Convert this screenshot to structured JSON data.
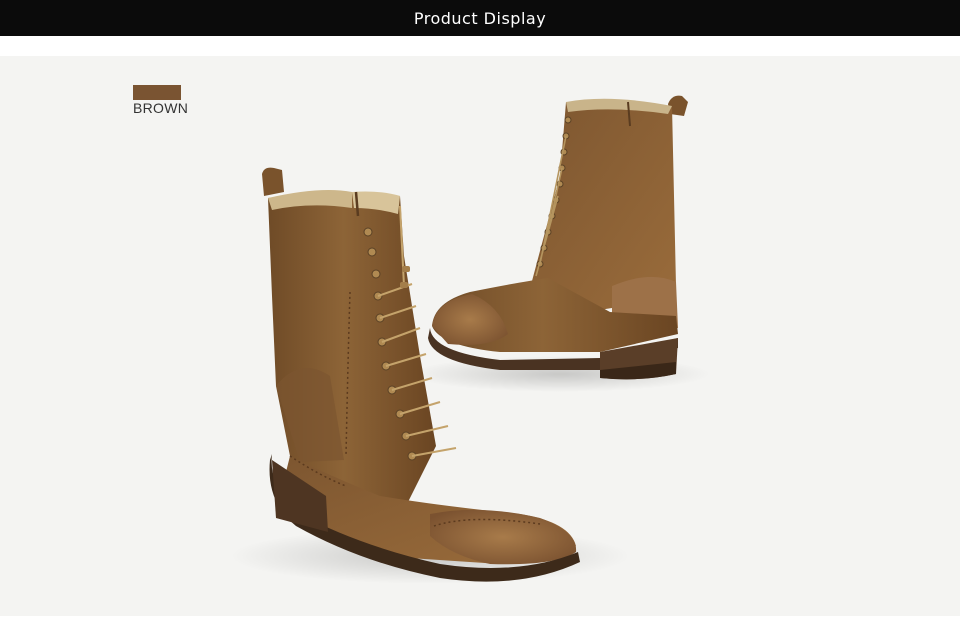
{
  "header": {
    "title": "Product Display"
  },
  "color_option": {
    "label": "BROWN",
    "swatch_color": "#7a5432"
  },
  "colors": {
    "header_bg": "#0b0b0b",
    "stage_bg": "#f4f4f2",
    "suede": "#8a6236",
    "sole": "#4a3322"
  },
  "image": {
    "subject": "pair of brown suede lace-up mid-calf brogue boots"
  }
}
